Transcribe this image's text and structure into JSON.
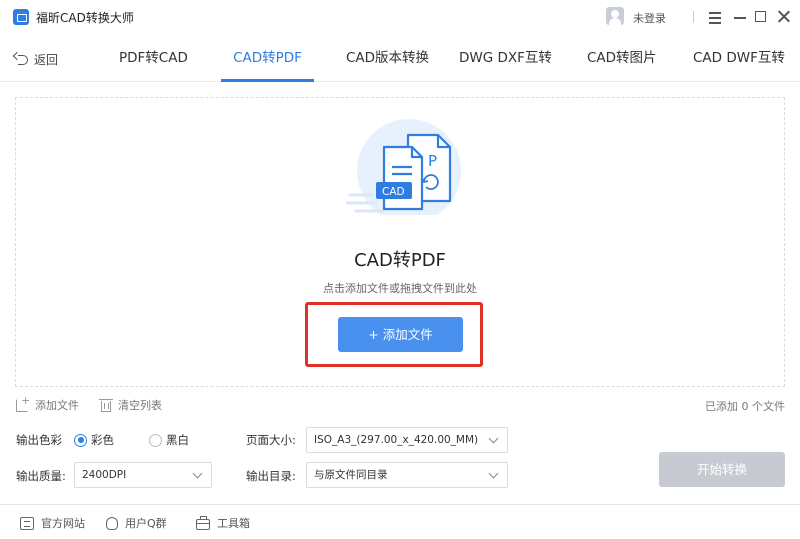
{
  "window": {
    "title": "福昕CAD转换大师",
    "user_status": "未登录"
  },
  "nav": {
    "back_label": "返回",
    "tabs": [
      {
        "label": "PDF转CAD",
        "active": false
      },
      {
        "label": "CAD转PDF",
        "active": true
      },
      {
        "label": "CAD版本转换",
        "active": false
      },
      {
        "label": "DWG DXF互转",
        "active": false
      },
      {
        "label": "CAD转图片",
        "active": false
      },
      {
        "label": "CAD DWF互转",
        "active": false
      }
    ]
  },
  "dropzone": {
    "title": "CAD转PDF",
    "hint": "点击添加文件或拖拽文件到此处",
    "add_button": "+ 添加文件",
    "illustration": {
      "doc_label": "CAD",
      "pdf_letter": "P"
    }
  },
  "file_actions": {
    "add_file": "添加文件",
    "clear_list": "清空列表",
    "added_count": "已添加 0 个文件"
  },
  "settings": {
    "color_label": "输出色彩",
    "color_options": [
      {
        "label": "彩色",
        "checked": true
      },
      {
        "label": "黑白",
        "checked": false
      }
    ],
    "page_size_label": "页面大小:",
    "page_size_value": "ISO_A3_(297.00_x_420.00_MM)",
    "quality_label": "输出质量:",
    "quality_value": "2400DPI",
    "output_dir_label": "输出目录:",
    "output_dir_value": "与原文件同目录",
    "start_button": "开始转换"
  },
  "footer": {
    "website": "官方网站",
    "qq_group": "用户Q群",
    "toolbox": "工具箱"
  },
  "colors": {
    "accent": "#2f7de1",
    "primary_button": "#4a90ee",
    "disabled_button": "#c7cbd1",
    "highlight_box": "#e0302a"
  }
}
